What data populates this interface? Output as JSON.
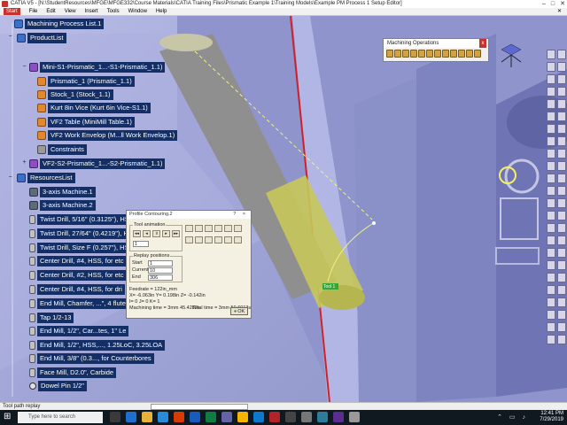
{
  "window": {
    "title": "CATIA V5 - [N:\\StudentResources\\MFGE\\MFGE332\\Course Materials\\CATIA Training Files\\Prismatic Example 1\\Training Models\\Example PM Process 1 Setup Editor]"
  },
  "menu": {
    "items": [
      "Start",
      "File",
      "Edit",
      "View",
      "Insert",
      "Tools",
      "Window",
      "Help"
    ]
  },
  "tree": {
    "nodes": [
      {
        "label": "Machining Process List.1"
      },
      {
        "label": "ProductList"
      },
      {
        "label": "Mini-S1-Prismatic_1...-S1-Prismatic_1.1)"
      },
      {
        "label": "Prismatic_1 (Prismatic_1.1)"
      },
      {
        "label": "Stock_1 (Stock_1.1)"
      },
      {
        "label": "Kurt 8in Vice (Kurt 6in Vice-S1.1)"
      },
      {
        "label": "VF2 Table (MiniMill Table.1)"
      },
      {
        "label": "VF2 Work Envelop (M...ll Work Envelop.1)"
      },
      {
        "label": "Constraints"
      },
      {
        "label": "VF2-S2-Prismatic_1...-S2-Prismatic_1.1)"
      },
      {
        "label": "ResourcesList"
      },
      {
        "label": "3-axis Machine.1"
      },
      {
        "label": "3-axis Machine.2"
      },
      {
        "label": "Twist Drill, 5/16\" (0.3125\"), HSS"
      },
      {
        "label": "Twist Drill, 27/64\" (0.4219\"), HSS"
      },
      {
        "label": "Twist Drill, Size F (0.257\"), HSS"
      },
      {
        "label": "Center Drill, #4, HSS, for etc"
      },
      {
        "label": "Center Drill, #2, HSS, for etc"
      },
      {
        "label": "Center Drill, #4, HSS, for dri"
      },
      {
        "label": "End Mill, Chamfer, ...\", 4 flute"
      },
      {
        "label": "Tap 1/2-13"
      },
      {
        "label": "End Mill, 1/2\", Car...tes, 1\" Le"
      },
      {
        "label": "End Mill, 1/2\", HSS,..., 1.25LoC, 3.25LOA"
      },
      {
        "label": "End Mill, 3/8\" (0.3..., for Counterbores"
      },
      {
        "label": "Face Mill, D2.0\", Carbide"
      },
      {
        "label": "Dowel Pin 1/2\""
      }
    ]
  },
  "machining_ops": {
    "title": "Machining Operations",
    "close": "x"
  },
  "dialog": {
    "title": "Profile Contouring.2",
    "window_controls": "? ×",
    "tool_animation_label": "Tool animation",
    "step_value": "1",
    "replay_positions_label": "Replay positions",
    "start_label": "Start",
    "start_value": "1",
    "current_label": "Current",
    "current_value": "10",
    "end_label": "End",
    "end_value": "306",
    "feedrate": "Feedrate = 122in_mm",
    "coords": "X= -6.063in Y= 0.198in Z= -0.142in",
    "ijk": "I= 0 J= 0 K= 1",
    "machining_time": "Machining time = 3mm 45.4282s",
    "total_time": "Total time = 3mm 50.6013s",
    "ok_label": "OK"
  },
  "viewport": {
    "tool_label": "Tool 1"
  },
  "statusbar": {
    "text": "Tool path replay"
  },
  "taskbar": {
    "search_placeholder": "Type here to search",
    "time": "12:41 PM",
    "date": "7/29/2019"
  }
}
